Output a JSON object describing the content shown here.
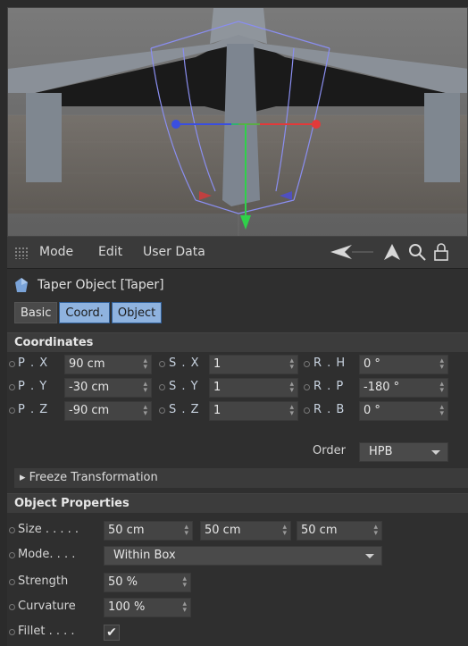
{
  "menubar": {
    "mode": "Mode",
    "edit": "Edit",
    "user_data": "User Data"
  },
  "object": {
    "title": "Taper Object [Taper]"
  },
  "tabs": [
    {
      "label": "Basic",
      "active": false
    },
    {
      "label": "Coord.",
      "active": true
    },
    {
      "label": "Object",
      "active": true
    }
  ],
  "coordinates": {
    "heading": "Coordinates",
    "px_label": "P . X",
    "px_value": "90 cm",
    "py_label": "P . Y",
    "py_value": "-30 cm",
    "pz_label": "P . Z",
    "pz_value": "-90 cm",
    "sx_label": "S . X",
    "sx_value": "1",
    "sy_label": "S . Y",
    "sy_value": "1",
    "sz_label": "S . Z",
    "sz_value": "1",
    "rh_label": "R . H",
    "rh_value": "0 °",
    "rp_label": "R . P",
    "rp_value": "-180 °",
    "rb_label": "R . B",
    "rb_value": "0 °",
    "order_label": "Order",
    "order_value": "HPB",
    "freeze_label": "Freeze Transformation"
  },
  "object_properties": {
    "heading": "Object Properties",
    "size_label": "Size . . . . .",
    "size_x": "50 cm",
    "size_y": "50 cm",
    "size_z": "50 cm",
    "mode_label": "Mode. . . .",
    "mode_value": "Within Box",
    "strength_label": "Strength",
    "strength_value": "50 %",
    "curvature_label": "Curvature",
    "curvature_value": "100 %",
    "fillet_label": "Fillet . . . .",
    "fillet_checked": "✔"
  },
  "colors": {
    "tab_active": "#8fb3df",
    "axis_x": "#e23a3a",
    "axis_y": "#2fd14a",
    "axis_z": "#3a4fe0",
    "deformer_cage": "#8a8ef0"
  },
  "icons": [
    "grip-icon",
    "arrow-left-icon",
    "arrow-up-icon",
    "search-icon",
    "lock-icon",
    "taper-object-icon",
    "spinner-icon",
    "caret-down-icon",
    "checkmark-icon"
  ]
}
